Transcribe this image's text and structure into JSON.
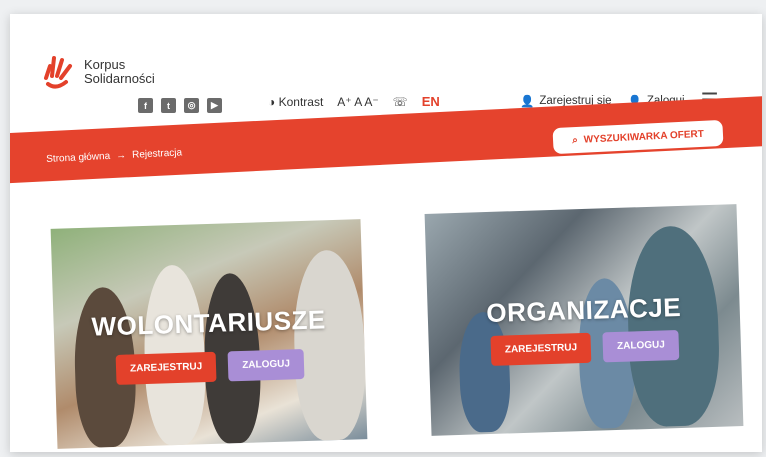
{
  "logo": {
    "line1": "Korpus",
    "line2": "Solidarności"
  },
  "social_icons": [
    "facebook-icon",
    "twitter-icon",
    "instagram-icon",
    "youtube-icon"
  ],
  "utility": {
    "contrast_label": "Kontrast",
    "font_size_label": "A⁺ A A⁻",
    "lang_label": "EN"
  },
  "account": {
    "register_label": "Zarejestruj się",
    "login_label": "Zaloguj"
  },
  "breadcrumb": {
    "home": "Strona główna",
    "arrow": "→",
    "current": "Rejestracja"
  },
  "search_button_label": "WYSZUKIWARKA OFERT",
  "cards": {
    "volunteers": {
      "title": "WOLONTARIUSZE",
      "register": "ZAREJESTRUJ",
      "login": "ZALOGUJ"
    },
    "organizations": {
      "title": "ORGANIZACJE",
      "register": "ZAREJESTRUJ",
      "login": "ZALOGUJ"
    }
  },
  "colors": {
    "accent_red": "#e3412b",
    "purple": "#a98ed6"
  }
}
